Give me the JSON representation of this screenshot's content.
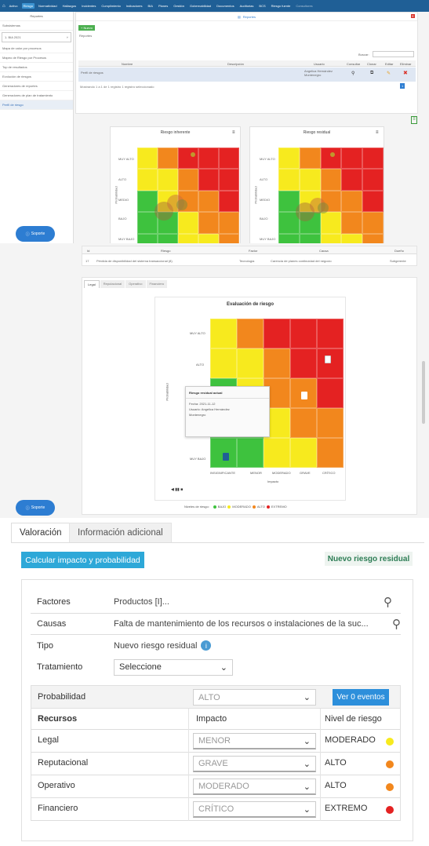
{
  "topnav": [
    "Activo",
    "Riesgo",
    "Normatividad",
    "Hallazgos",
    "Incidentes",
    "Cumplimiento",
    "Indicadores",
    "BIA",
    "Planes",
    "Gestión",
    "Gobernabilidad",
    "Documentos",
    "Auditorias",
    "BCS",
    "Riesgo fuente",
    "Consultores"
  ],
  "sidebar1": {
    "header": "Reportes",
    "items": [
      "Subsistemas",
      "1. BIA 2021",
      "Mapa de calor por procesos",
      "Mapeo de Riesgo por Procesos",
      "Top de resultados",
      "Evolución de riesgos",
      "Generadores de reportes",
      "Generadores de plan de tratamiento",
      "Perfil de riesgo"
    ]
  },
  "reports_header": "Reportes",
  "reports_button": "+ Nuevo",
  "reports_sub": "Reportes",
  "search_label": "Buscar:",
  "table1": {
    "headers": [
      "Nombre",
      "Descripción",
      "Usuario",
      "Consultar",
      "Clonar",
      "Editar",
      "Eliminar"
    ],
    "row": [
      "Perfil de riesgos",
      "",
      "Angelica Hernández Montenegro"
    ],
    "footer": "Mostrando 1 a 1 de 1 registro   1 registro seleccionado",
    "page": "1"
  },
  "chart_inherent": {
    "title": "Riesgo inherente",
    "ylabel": "Probabilidad",
    "ylevels": [
      "MUY ALTO",
      "ALTO",
      "MEDIO",
      "BAJO",
      "MUY BAJO"
    ]
  },
  "chart_residual": {
    "title": "Riesgo residual",
    "ylabel": "Probabilidad",
    "ylevels": [
      "MUY ALTO",
      "ALTO",
      "MEDIO",
      "BAJO",
      "MUY BAJO"
    ]
  },
  "support_label": "Soporte",
  "table2": {
    "headers": [
      "Id",
      "Riesgo",
      "Factor",
      "Causa",
      "Dueño"
    ],
    "row": [
      "17",
      "Pérdida de disponibilidad del sistema transaccional (8)",
      "Tecnología",
      "Carencia de planes continuidad del negocio",
      "Subgerente"
    ]
  },
  "tabs2": [
    "Legal",
    "Reputacional",
    "Operativo",
    "Financiero"
  ],
  "eval_chart": {
    "title": "Evaluación de riesgo",
    "ylabel": "Probabilidad",
    "xlabel": "Impacto",
    "ylevels": [
      "MUY ALTO",
      "ALTO",
      "MEDIO",
      "BAJO",
      "MUY BAJO"
    ],
    "xlevels": [
      "INSIGNIFICANTE",
      "MENOR",
      "MODERADO",
      "GRAVE",
      "CRÍTICO"
    ],
    "tooltip_title": "Riesgo residual actual",
    "tooltip_lines": [
      "Fecha: 2021-11-12",
      "Usuario: Angelica Hernández",
      "Montenegro"
    ],
    "legend_label": "Niveles de riesgo:",
    "legend": [
      "BAJO",
      "MODERADO",
      "ALTO",
      "EXTREMO"
    ]
  },
  "valoracion": {
    "tabs": [
      "Valoración",
      "Información adicional"
    ],
    "calc_button": "Calcular impacto y probabilidad",
    "new_risk_badge": "Nuevo riesgo residual",
    "factores_label": "Factores",
    "factores_value": "Productos [I]...",
    "causas_label": "Causas",
    "causas_value": "Falta de mantenimiento de los recursos o instalaciones de la suc...",
    "tipo_label": "Tipo",
    "tipo_value": "Nuevo riesgo residual",
    "tratamiento_label": "Tratamiento",
    "tratamiento_value": "Seleccione",
    "probabilidad_label": "Probabilidad",
    "probabilidad_value": "ALTO",
    "eventos_button": "Ver 0 eventos",
    "col_recursos": "Recursos",
    "col_impacto": "Impacto",
    "col_nivel": "Nivel de riesgo",
    "rows": [
      {
        "recurso": "Legal",
        "impacto": "MENOR",
        "nivel": "MODERADO",
        "color": "#f7ea1e"
      },
      {
        "recurso": "Reputacional",
        "impacto": "GRAVE",
        "nivel": "ALTO",
        "color": "#f2871d"
      },
      {
        "recurso": "Operativo",
        "impacto": "MODERADO",
        "nivel": "ALTO",
        "color": "#f2871d"
      },
      {
        "recurso": "Financiero",
        "impacto": "CRÍTICO",
        "nivel": "EXTREMO",
        "color": "#e42222"
      }
    ]
  }
}
